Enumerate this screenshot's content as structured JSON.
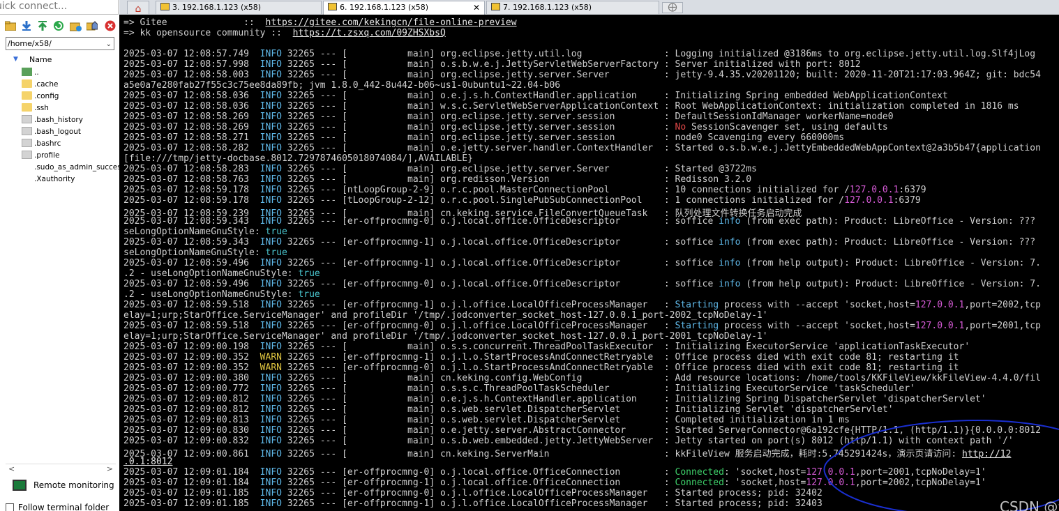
{
  "left_panel": {
    "quick_connect": "uick connect...",
    "path": "/home/x58/",
    "tree_header": "Name",
    "tree_items": [
      {
        "label": "..",
        "kind": "up"
      },
      {
        "label": ".cache",
        "kind": "folder"
      },
      {
        "label": ".config",
        "kind": "folder"
      },
      {
        "label": ".ssh",
        "kind": "folder"
      },
      {
        "label": ".bash_history",
        "kind": "file"
      },
      {
        "label": ".bash_logout",
        "kind": "file"
      },
      {
        "label": ".bashrc",
        "kind": "file"
      },
      {
        "label": ".profile",
        "kind": "file"
      },
      {
        "label": ".sudo_as_admin_succes",
        "kind": "blank"
      },
      {
        "label": ".Xauthority",
        "kind": "blank"
      }
    ],
    "remote_monitoring": "Remote monitoring",
    "follow_folder": "Follow terminal folder",
    "toolbar_icons": [
      "open-folder-icon",
      "download-icon",
      "upload-icon",
      "refresh-icon",
      "new-folder-icon",
      "home-icon",
      "delete-icon"
    ]
  },
  "tabs": [
    {
      "label": "3. 192.168.1.123 (x58)",
      "active": false
    },
    {
      "label": "6. 192.168.1.123 (x58)",
      "active": true
    },
    {
      "label": "7. 192.168.1.123 (x58)",
      "active": false
    }
  ],
  "terminal": {
    "lines": [
      [
        [
          "=> Gitee              ::  ",
          ""
        ],
        [
          "https://gitee.com/kekingcn/file-online-preview",
          "link"
        ]
      ],
      [
        [
          "=> kk opensource community ::  ",
          ""
        ],
        [
          "https://t.zsxq.com/09ZHSXbsQ",
          "link"
        ]
      ],
      [
        [
          "",
          ""
        ]
      ],
      [
        [
          "2025-03-07 12:08:57.749  ",
          ""
        ],
        [
          "INFO",
          "info"
        ],
        [
          " 32265 --- [           main] org.eclipse.jetty.util.log               : Logging initialized @3186ms to org.eclipse.jetty.util.log.Slf4jLog",
          ""
        ]
      ],
      [
        [
          "2025-03-07 12:08:57.998  ",
          ""
        ],
        [
          "INFO",
          "info"
        ],
        [
          " 32265 --- [           main] o.s.b.w.e.j.JettyServletWebServerFactory : Server initialized with port: 8012",
          ""
        ]
      ],
      [
        [
          "2025-03-07 12:08:58.003  ",
          ""
        ],
        [
          "INFO",
          "info"
        ],
        [
          " 32265 --- [           main] org.eclipse.jetty.server.Server          : jetty-9.4.35.v20201120; built: 2020-11-20T21:17:03.964Z; git: bdc54",
          ""
        ]
      ],
      [
        [
          "a5e0a7e280fab27f55c3c75ee8da89fb; jvm 1.8.0_442-8u442-b06~us1-0ubuntu1~22.04-b06",
          ""
        ]
      ],
      [
        [
          "2025-03-07 12:08:58.036  ",
          ""
        ],
        [
          "INFO",
          "info"
        ],
        [
          " 32265 --- [           main] o.e.j.s.h.ContextHandler.application     : Initializing Spring embedded WebApplicationContext",
          ""
        ]
      ],
      [
        [
          "2025-03-07 12:08:58.036  ",
          ""
        ],
        [
          "INFO",
          "info"
        ],
        [
          " 32265 --- [           main] w.s.c.ServletWebServerApplicationContext : Root WebApplicationContext: initialization completed in 1816 ms",
          ""
        ]
      ],
      [
        [
          "2025-03-07 12:08:58.269  ",
          ""
        ],
        [
          "INFO",
          "info"
        ],
        [
          " 32265 --- [           main] org.eclipse.jetty.server.session         : DefaultSessionIdManager workerName=node0",
          ""
        ]
      ],
      [
        [
          "2025-03-07 12:08:58.269  ",
          ""
        ],
        [
          "INFO",
          "info"
        ],
        [
          " 32265 --- [           main] org.eclipse.jetty.server.session         : ",
          ""
        ],
        [
          "No",
          "red"
        ],
        [
          " SessionScavenger set, using defaults",
          ""
        ]
      ],
      [
        [
          "2025-03-07 12:08:58.271  ",
          ""
        ],
        [
          "INFO",
          "info"
        ],
        [
          " 32265 --- [           main] org.eclipse.jetty.server.session         : node0 Scavenging every 660000ms",
          ""
        ]
      ],
      [
        [
          "2025-03-07 12:08:58.282  ",
          ""
        ],
        [
          "INFO",
          "info"
        ],
        [
          " 32265 --- [           main] o.e.jetty.server.handler.ContextHandler  : Started o.s.b.w.e.j.JettyEmbeddedWebAppContext@2a3b5b47{application",
          ""
        ]
      ],
      [
        [
          "[file:///tmp/jetty-docbase.8012.7297874605018074084/],AVAILABLE}",
          ""
        ]
      ],
      [
        [
          "2025-03-07 12:08:58.283  ",
          ""
        ],
        [
          "INFO",
          "info"
        ],
        [
          " 32265 --- [           main] org.eclipse.jetty.server.Server          : Started @3722ms",
          ""
        ]
      ],
      [
        [
          "2025-03-07 12:08:58.763  ",
          ""
        ],
        [
          "INFO",
          "info"
        ],
        [
          " 32265 --- [           main] org.redisson.Version                     : Redisson 3.2.0",
          ""
        ]
      ],
      [
        [
          "2025-03-07 12:08:59.178  ",
          ""
        ],
        [
          "INFO",
          "info"
        ],
        [
          " 32265 --- [ntLoopGroup-2-9] o.r.c.pool.MasterConnectionPool          : 10 connections initialized for /",
          ""
        ],
        [
          "127.0.0.1",
          "mag"
        ],
        [
          ":6379",
          ""
        ]
      ],
      [
        [
          "2025-03-07 12:08:59.178  ",
          ""
        ],
        [
          "INFO",
          "info"
        ],
        [
          " 32265 --- [tLoopGroup-2-12] o.r.c.pool.SinglePubSubConnectionPool    : 1 connections initialized for /",
          ""
        ],
        [
          "127.0.0.1",
          "mag"
        ],
        [
          ":6379",
          ""
        ]
      ],
      [
        [
          "2025-03-07 12:08:59.239  ",
          ""
        ],
        [
          "INFO",
          "info"
        ],
        [
          " 32265 --- [           main] cn.keking.service.FileConvertQueueTask   : 队列处理文件转换任务启动完成",
          ""
        ]
      ],
      [
        [
          "2025-03-07 12:08:59.343  ",
          ""
        ],
        [
          "INFO",
          "info"
        ],
        [
          " 32265 --- [er-offprocmng-0] o.j.local.office.OfficeDescriptor        : soffice ",
          ""
        ],
        [
          "info",
          "info"
        ],
        [
          " (from exec path): Product: LibreOffice - Version: ??? ",
          ""
        ]
      ],
      [
        [
          "seLongOptionNameGnuStyle: ",
          ""
        ],
        [
          "true",
          "cyan"
        ]
      ],
      [
        [
          "2025-03-07 12:08:59.343  ",
          ""
        ],
        [
          "INFO",
          "info"
        ],
        [
          " 32265 --- [er-offprocmng-1] o.j.local.office.OfficeDescriptor        : soffice ",
          ""
        ],
        [
          "info",
          "info"
        ],
        [
          " (from exec path): Product: LibreOffice - Version: ??? ",
          ""
        ]
      ],
      [
        [
          "seLongOptionNameGnuStyle: ",
          ""
        ],
        [
          "true",
          "cyan"
        ]
      ],
      [
        [
          "2025-03-07 12:08:59.496  ",
          ""
        ],
        [
          "INFO",
          "info"
        ],
        [
          " 32265 --- [er-offprocmng-1] o.j.local.office.OfficeDescriptor        : soffice ",
          ""
        ],
        [
          "info",
          "info"
        ],
        [
          " (from help output): Product: LibreOffice - Version: 7.",
          ""
        ]
      ],
      [
        [
          ".2 - useLongOptionNameGnuStyle: ",
          ""
        ],
        [
          "true",
          "cyan"
        ]
      ],
      [
        [
          "2025-03-07 12:08:59.496  ",
          ""
        ],
        [
          "INFO",
          "info"
        ],
        [
          " 32265 --- [er-offprocmng-0] o.j.local.office.OfficeDescriptor        : soffice ",
          ""
        ],
        [
          "info",
          "info"
        ],
        [
          " (from help output): Product: LibreOffice - Version: 7.",
          ""
        ]
      ],
      [
        [
          ".2 - useLongOptionNameGnuStyle: ",
          ""
        ],
        [
          "true",
          "cyan"
        ]
      ],
      [
        [
          "2025-03-07 12:08:59.518  ",
          ""
        ],
        [
          "INFO",
          "info"
        ],
        [
          " 32265 --- [er-offprocmng-1] o.j.l.office.LocalOfficeProcessManager   : ",
          ""
        ],
        [
          "Starting",
          "info"
        ],
        [
          " process with --accept 'socket,host=",
          ""
        ],
        [
          "127.0.0.1",
          "mag"
        ],
        [
          ",port=2002,tcp",
          ""
        ]
      ],
      [
        [
          "elay=1;urp;StarOffice.ServiceManager' and profileDir '/tmp/.jodconverter_socket_host-127.0.0.1_port-2002_tcpNoDelay-1'",
          ""
        ]
      ],
      [
        [
          "2025-03-07 12:08:59.518  ",
          ""
        ],
        [
          "INFO",
          "info"
        ],
        [
          " 32265 --- [er-offprocmng-0] o.j.l.office.LocalOfficeProcessManager   : ",
          ""
        ],
        [
          "Starting",
          "info"
        ],
        [
          " process with --accept 'socket,host=",
          ""
        ],
        [
          "127.0.0.1",
          "mag"
        ],
        [
          ",port=2001,tcp",
          ""
        ]
      ],
      [
        [
          "elay=1;urp;StarOffice.ServiceManager' and profileDir '/tmp/.jodconverter_socket_host-127.0.0.1_port-2001_tcpNoDelay-1'",
          ""
        ]
      ],
      [
        [
          "2025-03-07 12:09:00.198  ",
          ""
        ],
        [
          "INFO",
          "info"
        ],
        [
          " 32265 --- [           main] o.s.s.concurrent.ThreadPoolTaskExecutor  : Initializing ExecutorService 'applicationTaskExecutor'",
          ""
        ]
      ],
      [
        [
          "2025-03-07 12:09:00.352  ",
          ""
        ],
        [
          "WARN",
          "warn"
        ],
        [
          " 32265 --- [er-offprocmng-1] o.j.l.o.StartProcessAndConnectRetryable  : Office process died with exit code 81; restarting it",
          ""
        ]
      ],
      [
        [
          "2025-03-07 12:09:00.352  ",
          ""
        ],
        [
          "WARN",
          "warn"
        ],
        [
          " 32265 --- [er-offprocmng-0] o.j.l.o.StartProcessAndConnectRetryable  : Office process died with exit code 81; restarting it",
          ""
        ]
      ],
      [
        [
          "2025-03-07 12:09:00.380  ",
          ""
        ],
        [
          "INFO",
          "info"
        ],
        [
          " 32265 --- [           main] cn.keking.config.WebConfig               : Add resource locations: /home/tools/KKFileView/kkFileView-4.4.0/fil",
          ""
        ]
      ],
      [
        [
          "2025-03-07 12:09:00.772  ",
          ""
        ],
        [
          "INFO",
          "info"
        ],
        [
          " 32265 --- [           main] o.s.s.c.ThreadPoolTaskScheduler          : Initializing ExecutorService 'taskScheduler'",
          ""
        ]
      ],
      [
        [
          "2025-03-07 12:09:00.812  ",
          ""
        ],
        [
          "INFO",
          "info"
        ],
        [
          " 32265 --- [           main] o.e.j.s.h.ContextHandler.application     : Initializing Spring DispatcherServlet 'dispatcherServlet'",
          ""
        ]
      ],
      [
        [
          "2025-03-07 12:09:00.812  ",
          ""
        ],
        [
          "INFO",
          "info"
        ],
        [
          " 32265 --- [           main] o.s.web.servlet.DispatcherServlet        : Initializing Servlet 'dispatcherServlet'",
          ""
        ]
      ],
      [
        [
          "2025-03-07 12:09:00.813  ",
          ""
        ],
        [
          "INFO",
          "info"
        ],
        [
          " 32265 --- [           main] o.s.web.servlet.DispatcherServlet        : Completed initialization in 1 ms",
          ""
        ]
      ],
      [
        [
          "2025-03-07 12:09:00.830  ",
          ""
        ],
        [
          "INFO",
          "info"
        ],
        [
          " 32265 --- [           main] o.e.jetty.server.AbstractConnector       : Started ServerConnector@6a192cfe{HTTP/1.1, (http/1.1)}{0.0.0.0:8012",
          ""
        ]
      ],
      [
        [
          "2025-03-07 12:09:00.832  ",
          ""
        ],
        [
          "INFO",
          "info"
        ],
        [
          " 32265 --- [           main] o.s.b.web.embedded.jetty.JettyWebServer  : Jetty started on port(s) 8012 (http/1.1) with context path '/'",
          ""
        ]
      ],
      [
        [
          "2025-03-07 12:09:00.861  ",
          ""
        ],
        [
          "INFO",
          "info"
        ],
        [
          " 32265 --- [           main] cn.keking.ServerMain                     : kkFileView 服务启动完成，耗时:5.745291424s，演示页请访问: ",
          ""
        ],
        [
          "http://12",
          "link"
        ]
      ],
      [
        [
          ".0.1:8012",
          "link"
        ]
      ],
      [
        [
          "2025-03-07 12:09:01.184  ",
          ""
        ],
        [
          "INFO",
          "info"
        ],
        [
          " 32265 --- [er-offprocmng-0] o.j.local.office.OfficeConnection        : ",
          ""
        ],
        [
          "Connected",
          "green"
        ],
        [
          ": 'socket,host=",
          ""
        ],
        [
          "127.0.0.1",
          "mag"
        ],
        [
          ",port=2001,tcpNoDelay=1'",
          ""
        ]
      ],
      [
        [
          "2025-03-07 12:09:01.184  ",
          ""
        ],
        [
          "INFO",
          "info"
        ],
        [
          " 32265 --- [er-offprocmng-1] o.j.local.office.OfficeConnection        : ",
          ""
        ],
        [
          "Connected",
          "green"
        ],
        [
          ": 'socket,host=",
          ""
        ],
        [
          "127.0.0.1",
          "mag"
        ],
        [
          ",port=2002,tcpNoDelay=1'",
          ""
        ]
      ],
      [
        [
          "2025-03-07 12:09:01.185  ",
          ""
        ],
        [
          "INFO",
          "info"
        ],
        [
          " 32265 --- [er-offprocmng-0] o.j.l.office.LocalOfficeProcessManager   : Started process; pid: 32402",
          ""
        ]
      ],
      [
        [
          "2025-03-07 12:09:01.185  ",
          ""
        ],
        [
          "INFO",
          "info"
        ],
        [
          " 32265 --- [er-offprocmng-1] o.j.l.office.LocalOfficeProcessManager   : Started process; pid: 32403",
          ""
        ]
      ]
    ]
  },
  "watermark": "CSDN @浪淘沙jkp",
  "colors": {
    "info": "#5fb8e8",
    "warn": "#e0c640",
    "error_word": "#e04848",
    "ip": "#d65ad6",
    "annotation_ellipse": "#1a2fd0"
  }
}
